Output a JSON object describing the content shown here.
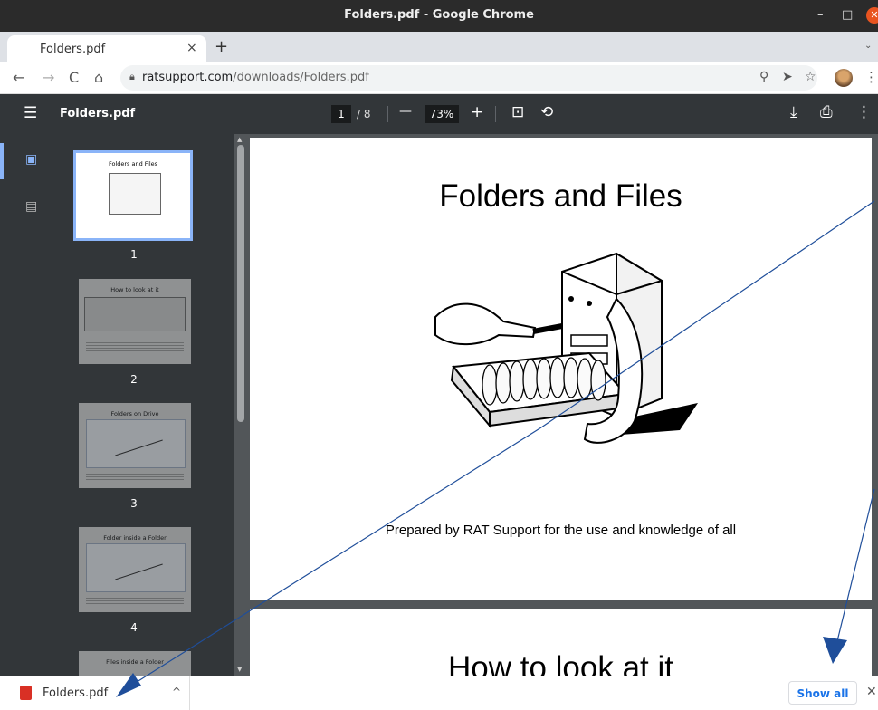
{
  "window": {
    "title": "Folders.pdf - Google Chrome",
    "minimize": "–",
    "maximize": "□",
    "close": "✕"
  },
  "tabs": [
    {
      "label": "Folders.pdf",
      "close": "×"
    }
  ],
  "newtab": "+",
  "tabmenu": "⌄",
  "toolbar": {
    "back": "←",
    "forward": "→",
    "reload": "C",
    "home": "⌂",
    "url_domain": "ratsupport.com",
    "url_path": "/downloads/Folders.pdf",
    "zoom_icon": "⚲",
    "send_icon": "➤",
    "star_icon": "☆",
    "menu": "⋮"
  },
  "pdf_toolbar": {
    "menu": "☰",
    "filename": "Folders.pdf",
    "page_current": "1",
    "page_total": "/ 8",
    "zoom_out": "—",
    "zoom": "73%",
    "zoom_in": "+",
    "fit_icon": "⊡",
    "rotate_icon": "⟲",
    "download_icon": "⤓",
    "print_icon": "⎙",
    "more": "⋮"
  },
  "sidebar": {
    "rail_icons": [
      "thumbnail-icon",
      "outline-icon"
    ],
    "thumbnails": [
      {
        "title": "Folders and Files",
        "number": "1"
      },
      {
        "title": "How to look at it",
        "number": "2"
      },
      {
        "title": "Folders on Drive",
        "number": "3"
      },
      {
        "title": "Folder inside a Folder",
        "number": "4"
      },
      {
        "title": "Files inside a Folder",
        "number": ""
      }
    ]
  },
  "document": {
    "page1_title": "Folders and Files",
    "page1_caption": "Prepared by RAT Support for the use and knowledge of all",
    "page2_title": "How to look at it"
  },
  "download_shelf": {
    "filename": "Folders.pdf",
    "caret": "^",
    "show_all": "Show all",
    "close": "✕"
  },
  "colors": {
    "accent": "#8ab4f8",
    "pdf_toolbar": "#323639",
    "viewer_bg": "#525659",
    "annotation": "#1f4e9a"
  }
}
